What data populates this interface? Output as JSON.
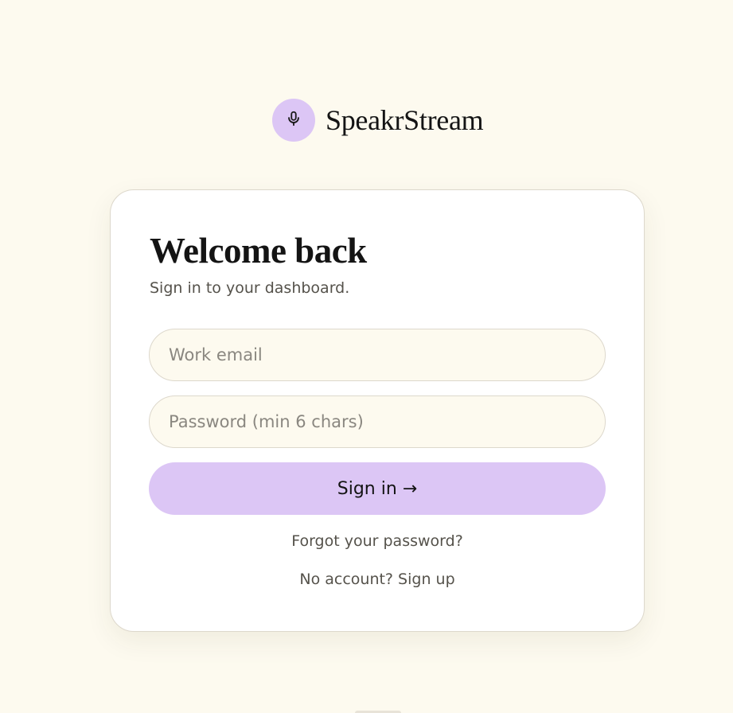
{
  "app": {
    "name": "SpeakrStream",
    "logo_icon": "microphone-icon",
    "accent_color": "#dcc6f5",
    "background_color": "#fdfaef"
  },
  "login": {
    "title": "Welcome back",
    "subtitle": "Sign in to your dashboard.",
    "email_placeholder": "Work email",
    "email_value": "",
    "password_placeholder": "Password (min 6 chars)",
    "password_value": "",
    "submit_label": "Sign in →",
    "forgot_label": "Forgot your password?",
    "signup_prompt": "No account? Sign up"
  }
}
